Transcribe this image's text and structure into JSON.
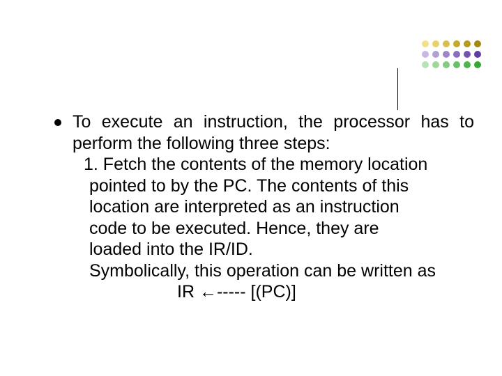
{
  "decoration": {
    "dot_colors_row1": [
      "#f5e08a",
      "#e8d36a",
      "#d7c14d",
      "#c4aa2c",
      "#b59a1a",
      "#a3890e"
    ],
    "dot_colors_row2": [
      "#c9b8e0",
      "#b49fd4",
      "#9f86c8",
      "#8a6dbc",
      "#7554b0",
      "#5f3ba4"
    ],
    "dot_colors_row3": [
      "#b9e2b4",
      "#9fd79b",
      "#84cb81",
      "#6ac068",
      "#50b44e",
      "#36a935"
    ]
  },
  "content": {
    "intro": "To execute an instruction, the processor  has to perform the following three steps:",
    "step1_l1": "1. Fetch the contents of the memory location",
    "step1_l2": "pointed to by the PC. The contents  of this",
    "step1_l3": "location are interpreted as an instruction",
    "step1_l4": "code to be executed. Hence, they are",
    "step1_l5": " loaded into the IR/ID.",
    "sym_l1": "Symbolically, this operation can be written as",
    "formula": "IR ←----- [(PC)]"
  }
}
